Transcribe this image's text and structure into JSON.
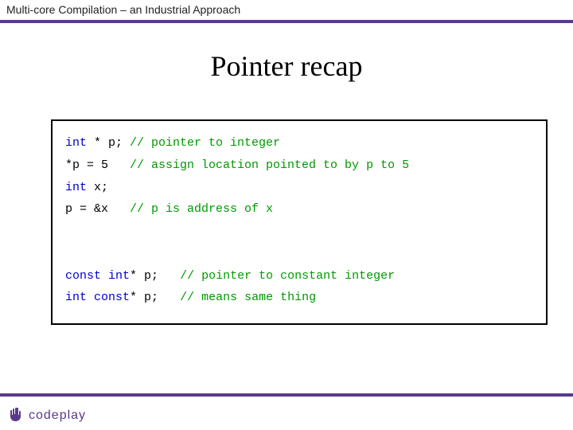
{
  "header": "Multi-core Compilation – an Industrial Approach",
  "title": "Pointer recap",
  "code": {
    "l1": {
      "kw": "int",
      "rest": " * p; ",
      "cm": "// pointer to integer"
    },
    "l2": {
      "lead": "*p = 5   ",
      "cm": "// assign location pointed to by p to 5"
    },
    "l3": {
      "kw": "int",
      "rest": " x;"
    },
    "l4": {
      "lead": "p = &x   ",
      "cm": "// p is address of x"
    },
    "l5": {
      "kw1": "const",
      "sp1": " ",
      "kw2": "int",
      "rest": "* p;   ",
      "cm": "// pointer to constant integer"
    },
    "l6": {
      "kw1": "int",
      "sp1": " ",
      "kw2": "const",
      "rest": "* p;   ",
      "cm": "// means same thing"
    }
  },
  "logo_text": "codeplay"
}
